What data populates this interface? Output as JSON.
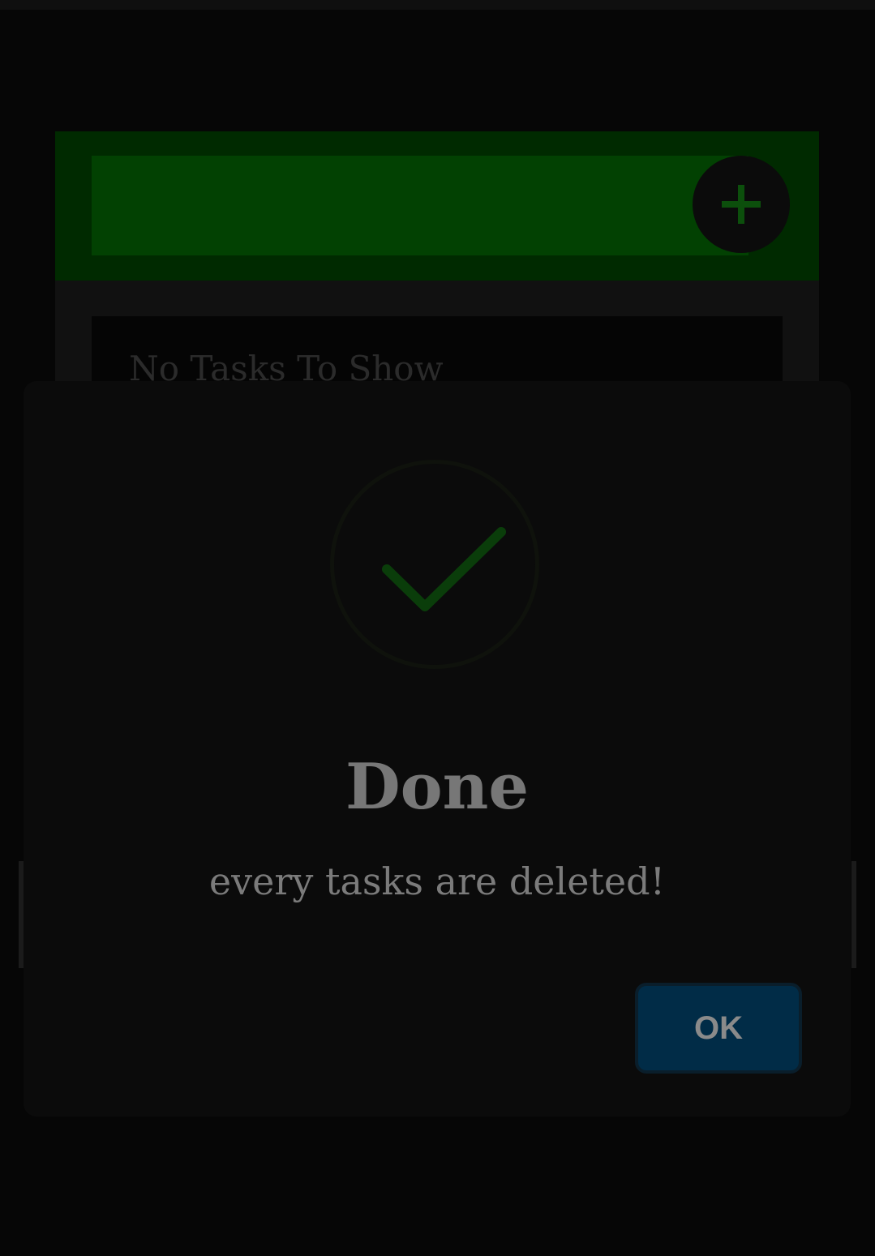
{
  "app": {
    "add_button_icon": "plus-icon",
    "empty_state_text": "No Tasks To Show",
    "colors": {
      "header_bg": "#002a00",
      "input_bg": "#024102",
      "plus_color": "#0c4f0c"
    }
  },
  "dialog": {
    "icon": "check-icon",
    "title": "Done",
    "message": "every tasks are deleted!",
    "ok_label": "OK",
    "colors": {
      "ok_bg": "#012c47",
      "check_color": "#0a3d0a"
    }
  }
}
